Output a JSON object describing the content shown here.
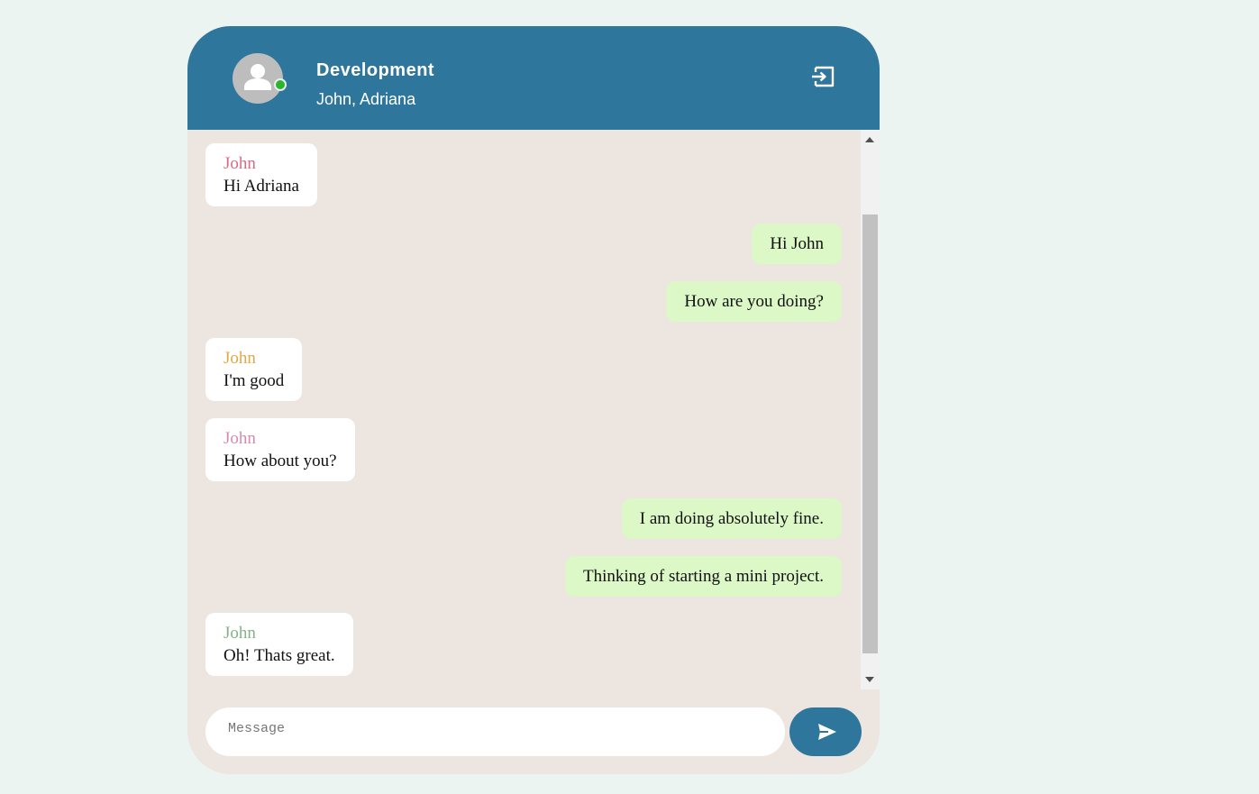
{
  "header": {
    "title": "Development",
    "members": "John, Adriana",
    "status": "online",
    "exit_icon": "exit-icon"
  },
  "messages": [
    {
      "direction": "incoming",
      "sender": "John",
      "text": "Hi Adriana",
      "sender_color": "#d96a86"
    },
    {
      "direction": "outgoing",
      "text": "Hi John"
    },
    {
      "direction": "outgoing",
      "text": "How are you doing?"
    },
    {
      "direction": "incoming",
      "sender": "John",
      "text": "I'm good",
      "sender_color": "#e0a845"
    },
    {
      "direction": "incoming",
      "sender": "John",
      "text": "How about you?",
      "sender_color": "#d78aae"
    },
    {
      "direction": "outgoing",
      "text": "I am doing absolutely fine."
    },
    {
      "direction": "outgoing",
      "text": "Thinking of starting a mini project."
    },
    {
      "direction": "incoming",
      "sender": "John",
      "text": "Oh! Thats great.",
      "sender_color": "#84b08a"
    }
  ],
  "composer": {
    "placeholder": "Message",
    "value": "",
    "send_icon": "send-icon"
  },
  "colors": {
    "header_bg": "#2f769c",
    "chat_bg": "#ece5e0",
    "outgoing_bubble": "#dcf8c6",
    "incoming_bubble": "#ffffff",
    "online_dot": "#2cb52c"
  }
}
